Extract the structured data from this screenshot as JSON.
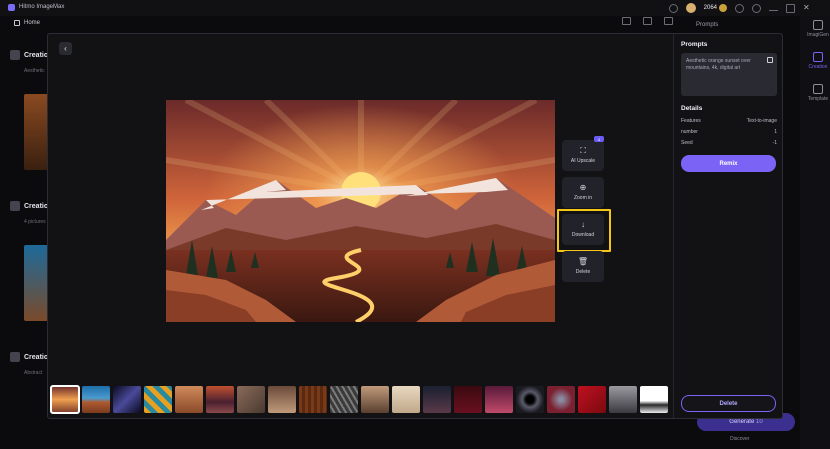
{
  "app": {
    "title": "Hitmo ImageMax",
    "credits": "2064",
    "home": "Home"
  },
  "background": {
    "sections": [
      {
        "title": "Creation",
        "sub": "Aesthetic"
      },
      {
        "title": "Creation",
        "sub": "4 pictures"
      },
      {
        "title": "Creation",
        "sub": "Abstract"
      }
    ],
    "panel_title": "Prompts",
    "rail": [
      {
        "label": "ImagiGen"
      },
      {
        "label": "Creation"
      },
      {
        "label": "Template"
      }
    ],
    "generate": "Generate",
    "generate_cost": "10",
    "discover": "Discover"
  },
  "viewer": {
    "tools": [
      {
        "label": "AI Upscale",
        "icon": "upscale-icon",
        "badge": "4"
      },
      {
        "label": "Zoom in",
        "icon": "zoom-in-icon"
      },
      {
        "label": "Download",
        "icon": "download-icon"
      },
      {
        "label": "Delete",
        "icon": "trash-icon"
      }
    ],
    "thumbnails_count": 20
  },
  "details_panel": {
    "prompts_heading": "Prompts",
    "prompt_text": "Aesthetic orange sunset over mountains, 4k, digital art",
    "details_heading": "Details",
    "rows": [
      {
        "label": "Features",
        "value": "Text-to-image"
      },
      {
        "label": "number",
        "value": "1"
      },
      {
        "label": "Seed",
        "value": "-1"
      }
    ],
    "remix": "Remix",
    "delete": "Delete"
  },
  "colors": {
    "accent": "#7a63f5",
    "highlight": "#f5c518",
    "panel": "#121215"
  }
}
